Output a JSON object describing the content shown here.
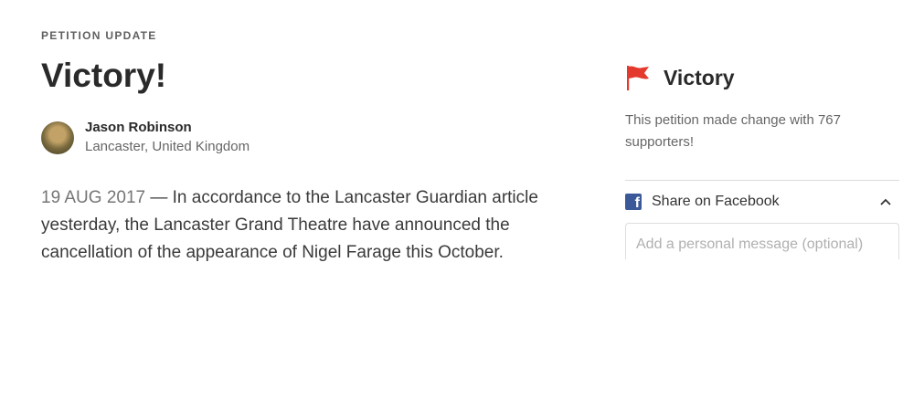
{
  "update": {
    "eyebrow": "PETITION UPDATE",
    "title": "Victory!",
    "author": {
      "name": "Jason Robinson",
      "location": "Lancaster, United Kingdom"
    },
    "date": "19 AUG 2017",
    "separator": " — ",
    "body": "In accordance to the Lancaster Guardian article yesterday, the Lancaster Grand Theatre have announced the cancellation of the appearance of Nigel Farage this October."
  },
  "sidebar": {
    "title": "Victory",
    "flag_icon": "flag-icon",
    "flag_color": "#e43a2e",
    "description": "This petition made change with 767 supporters!",
    "share": {
      "label": "Share on Facebook",
      "icon": "facebook-icon",
      "icon_color": "#3b5998",
      "chevron": "chevron-up-icon",
      "message_placeholder": "Add a personal message (optional)"
    }
  }
}
